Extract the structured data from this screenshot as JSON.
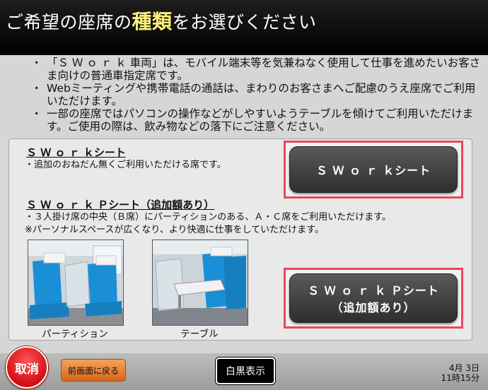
{
  "header": {
    "title_pre": "ご希望の座席の",
    "title_em": "種類",
    "title_post": "をお選びください"
  },
  "notes": [
    "「Ｓ Ｗ ｏ ｒ ｋ 車両」は、モバイル端末等を気兼ねなく使用して仕事を進めたいお客さま向けの普通車指定席です。",
    "Webミーティングや携帯電話の通話は、まわりのお客さまへご配慮のうえ座席でご利用いただけます。",
    "一部の座席ではパソコンの操作などがしやすいようテーブルを傾けてご利用いただけます。ご使用の際は、飲み物などの落下にご注意ください。"
  ],
  "section1": {
    "title": "Ｓ Ｗ ｏ ｒ ｋシート",
    "desc": "・追加のおねだん無くご利用いただける席です。"
  },
  "section2": {
    "title": "Ｓ Ｗ ｏ ｒ ｋ Ｐシート（追加額あり）",
    "desc1": "・３人掛け席の中央（Ｂ席）にパーティションのある、Ａ・Ｃ席をご利用いただけます。",
    "desc2": "※パーソナルスペースが広くなり、より快適に仕事をしていただけます。"
  },
  "buttons": {
    "swork": "Ｓ Ｗ ｏ ｒ ｋシート",
    "sworkp_line1": "Ｓ Ｗ ｏ ｒ ｋ Ｐシート",
    "sworkp_line2": "（追加額あり）"
  },
  "photos": {
    "caption1": "パーティション",
    "caption2": "テーブル"
  },
  "footer": {
    "cancel": "取消",
    "back": "前画面に戻る",
    "mono": "白黒表示",
    "date": "4月  3日",
    "time": "11時15分"
  },
  "colors": {
    "header_bg": "#000000",
    "title_highlight": "#fff27a",
    "selection_frame": "#e64a5a",
    "button_dark": "#3a3a3a",
    "cancel_red": "#d10f12",
    "back_orange": "#e07a2a",
    "seat_blue": "#1a8fd6"
  }
}
